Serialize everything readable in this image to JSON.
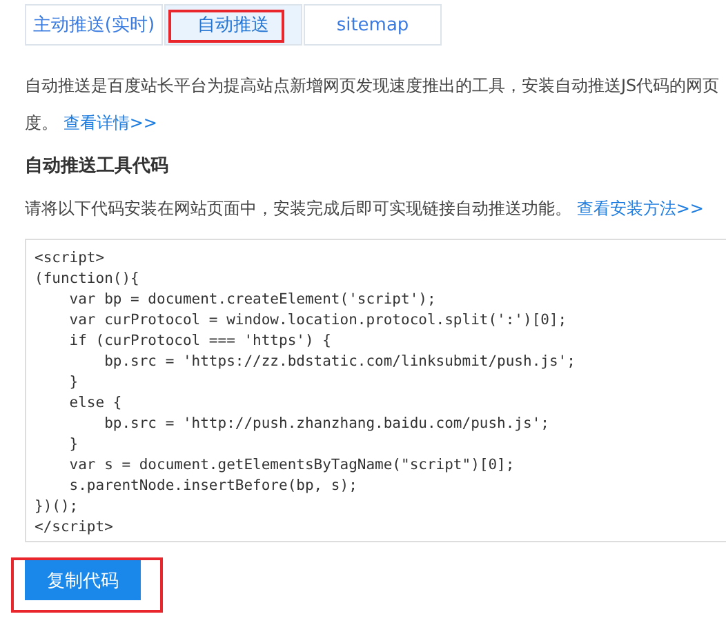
{
  "tabs": [
    {
      "label": "主动推送(实时)",
      "selected": false,
      "annotated": false
    },
    {
      "label": "自动推送",
      "selected": true,
      "annotated": true
    },
    {
      "label": "sitemap",
      "selected": false,
      "annotated": false
    }
  ],
  "intro": {
    "lines": [
      "自动推送是百度站长平台为提高站点新增网页发现速度推出的工具，安装自动推送JS代码的网页",
      "度。"
    ],
    "link": "查看详情>>"
  },
  "section_title": "自动推送工具代码",
  "instruction": {
    "text": "请将以下代码安装在网站页面中，安装完成后即可实现链接自动推送功能。",
    "link": "查看安装方法>>"
  },
  "code_lines": [
    "<script>",
    "(function(){",
    "    var bp = document.createElement('script');",
    "    var curProtocol = window.location.protocol.split(':')[0];",
    "    if (curProtocol === 'https') {",
    "        bp.src = 'https://zz.bdstatic.com/linksubmit/push.js';",
    "    }",
    "    else {",
    "        bp.src = 'http://push.zhanzhang.baidu.com/push.js';",
    "    }",
    "    var s = document.getElementsByTagName(\"script\")[0];",
    "    s.parentNode.insertBefore(bp, s);",
    "})();",
    "</script>"
  ],
  "copy_button": {
    "label": "复制代码",
    "annotated": true
  }
}
